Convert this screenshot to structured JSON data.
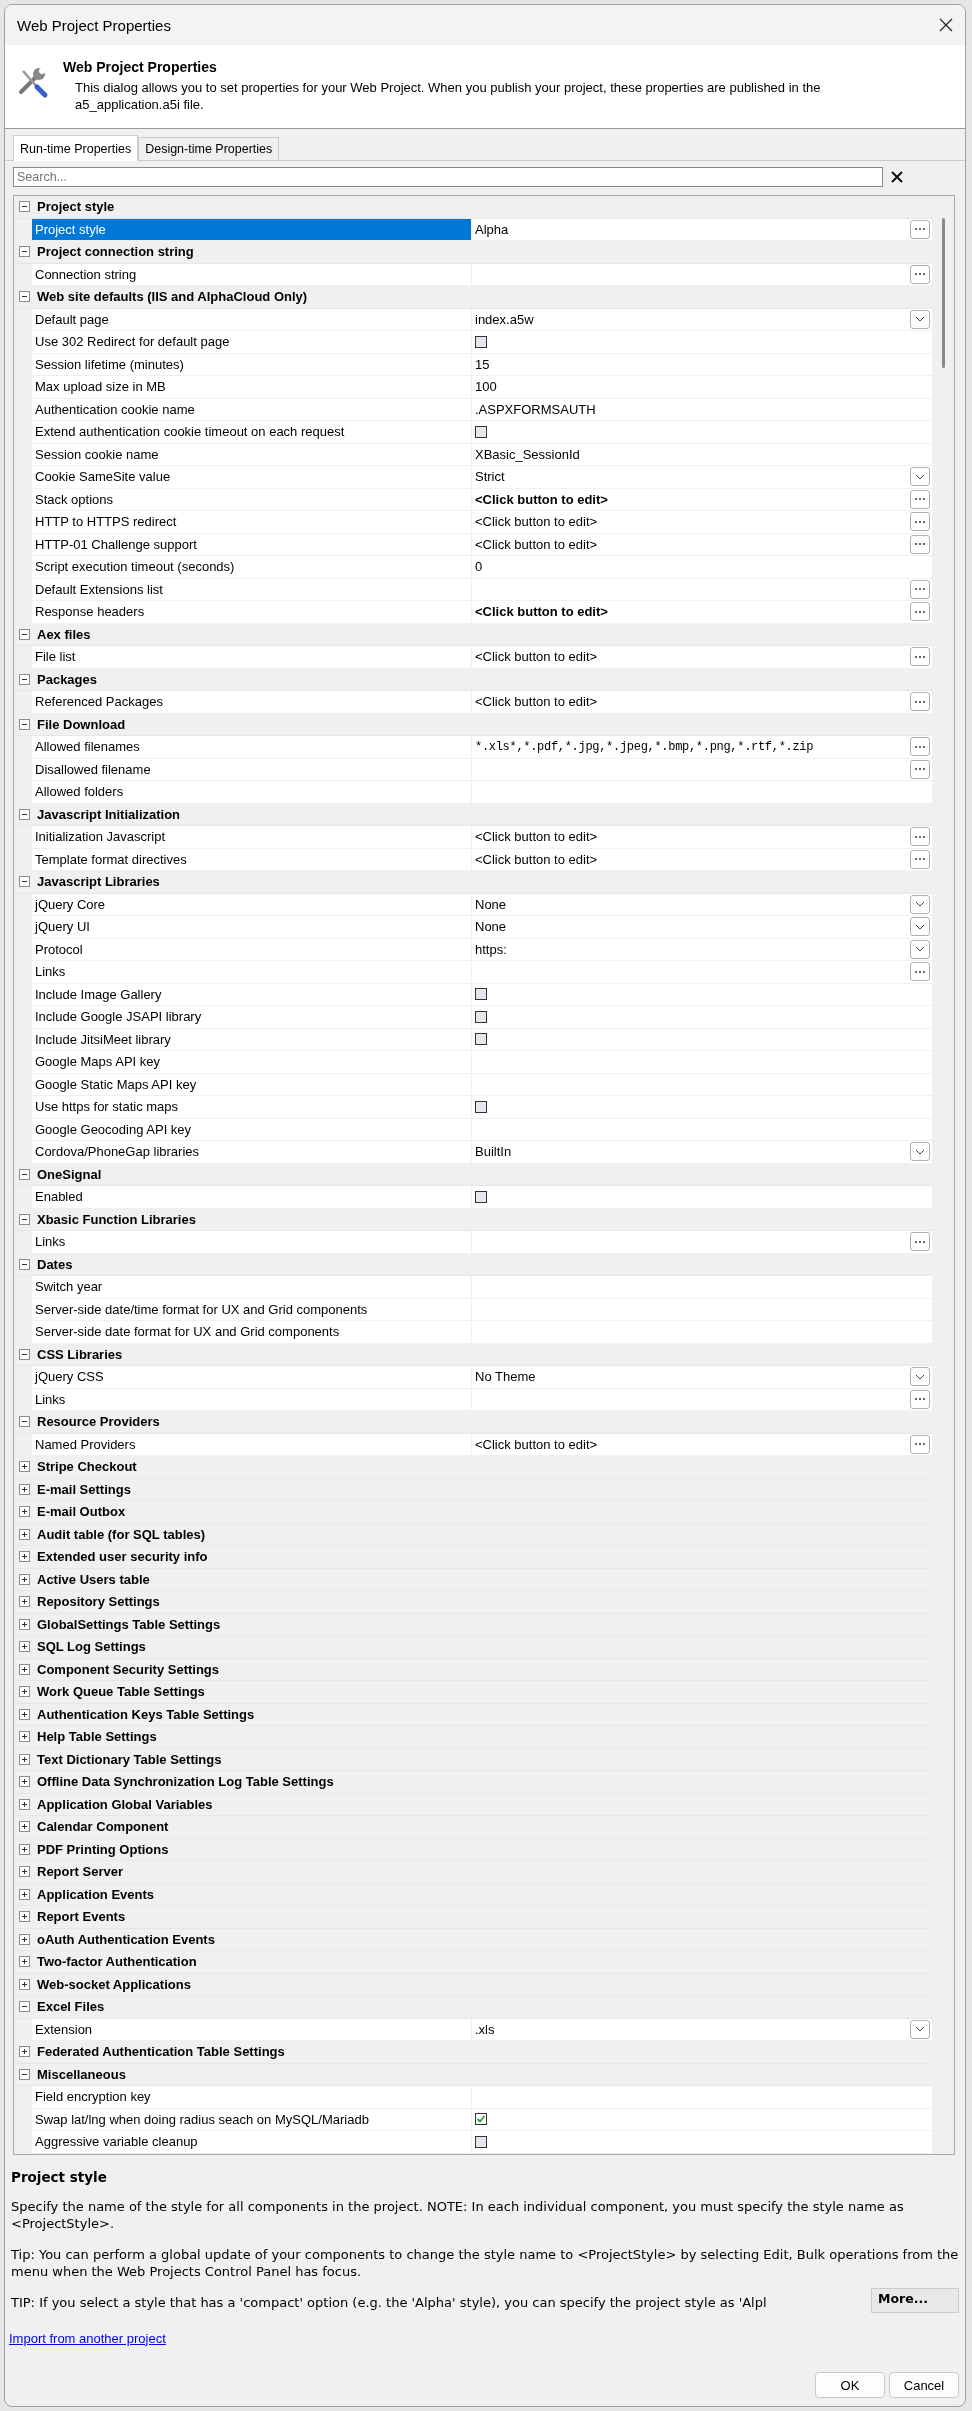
{
  "window": {
    "title": "Web Project Properties"
  },
  "header": {
    "title": "Web Project Properties",
    "description": "This dialog allows you to set properties for your Web Project. When you publish your project, these properties are published in the a5_application.a5i file."
  },
  "tabs": [
    {
      "label": "Run-time Properties",
      "selected": true
    },
    {
      "label": "Design-time Properties",
      "selected": false
    }
  ],
  "search": {
    "placeholder": "Search..."
  },
  "categories": [
    {
      "name": "Project style",
      "expanded": true,
      "properties": [
        {
          "name": "Project style",
          "kind": "text",
          "value": "Alpha",
          "button": {
            "kind": "ellipsis"
          },
          "selected": true
        }
      ]
    },
    {
      "name": "Project connection string",
      "expanded": true,
      "properties": [
        {
          "name": "Connection string",
          "kind": "text",
          "button": {
            "kind": "ellipsis"
          },
          "selected": false
        }
      ]
    },
    {
      "name": "Web site defaults (IIS and AlphaCloud Only)",
      "expanded": true,
      "properties": [
        {
          "name": "Default page",
          "kind": "text",
          "value": "index.a5w",
          "button": {
            "kind": "dropdown"
          },
          "selected": false
        },
        {
          "name": "Use 302 Redirect for default page",
          "kind": "checkbox",
          "checked": false,
          "selected": false
        },
        {
          "name": "Session lifetime (minutes)",
          "kind": "text",
          "value": "15",
          "selected": false
        },
        {
          "name": "Max upload size in MB",
          "kind": "text",
          "value": "100",
          "selected": false
        },
        {
          "name": "Authentication cookie name",
          "kind": "text",
          "value": ".ASPXFORMSAUTH",
          "selected": false
        },
        {
          "name": "Extend authentication cookie timeout on each request",
          "kind": "checkbox",
          "checked": false,
          "selected": false
        },
        {
          "name": "Session cookie name",
          "kind": "text",
          "value": "XBasic_SessionId",
          "selected": false
        },
        {
          "name": "Cookie SameSite value",
          "kind": "text",
          "value": "Strict",
          "button": {
            "kind": "dropdown"
          },
          "selected": false
        },
        {
          "name": "Stack options",
          "kind": "text",
          "value": "<Click button to edit>",
          "bold": true,
          "button": {
            "kind": "ellipsis"
          },
          "selected": false
        },
        {
          "name": "HTTP to HTTPS redirect",
          "kind": "text",
          "value": "<Click button to edit>",
          "button": {
            "kind": "ellipsis"
          },
          "selected": false
        },
        {
          "name": "HTTP-01 Challenge support",
          "kind": "text",
          "value": "<Click button to edit>",
          "button": {
            "kind": "ellipsis"
          },
          "selected": false
        },
        {
          "name": "Script execution timeout (seconds)",
          "kind": "text",
          "value": "0",
          "selected": false
        },
        {
          "name": "Default Extensions list",
          "kind": "text",
          "button": {
            "kind": "ellipsis"
          },
          "selected": false
        },
        {
          "name": "Response headers",
          "kind": "text",
          "value": "<Click button to edit>",
          "bold": true,
          "button": {
            "kind": "ellipsis"
          },
          "selected": false
        }
      ]
    },
    {
      "name": "Aex files",
      "expanded": true,
      "properties": [
        {
          "name": "File list",
          "kind": "text",
          "value": "<Click button to edit>",
          "button": {
            "kind": "ellipsis"
          },
          "selected": false
        }
      ]
    },
    {
      "name": "Packages",
      "expanded": true,
      "properties": [
        {
          "name": "Referenced Packages",
          "kind": "text",
          "value": "<Click button to edit>",
          "button": {
            "kind": "ellipsis"
          },
          "selected": false
        }
      ]
    },
    {
      "name": "File Download",
      "expanded": true,
      "properties": [
        {
          "name": "Allowed filenames",
          "kind": "text",
          "value": "*.xls*,*.pdf,*.jpg,*.jpeg,*.bmp,*.png,*.rtf,*.zip",
          "mono": true,
          "button": {
            "kind": "ellipsis"
          },
          "selected": false
        },
        {
          "name": "Disallowed filename",
          "kind": "text",
          "button": {
            "kind": "ellipsis"
          },
          "selected": false
        },
        {
          "name": "Allowed folders",
          "kind": "text",
          "selected": false
        }
      ]
    },
    {
      "name": "Javascript Initialization",
      "expanded": true,
      "properties": [
        {
          "name": "Initialization Javascript",
          "kind": "text",
          "value": "<Click button to edit>",
          "button": {
            "kind": "ellipsis"
          },
          "selected": false
        },
        {
          "name": "Template format directives",
          "kind": "text",
          "value": "<Click button to edit>",
          "button": {
            "kind": "ellipsis"
          },
          "selected": false
        }
      ]
    },
    {
      "name": "Javascript Libraries",
      "expanded": true,
      "properties": [
        {
          "name": "jQuery Core",
          "kind": "text",
          "value": "None",
          "button": {
            "kind": "dropdown"
          },
          "selected": false
        },
        {
          "name": "jQuery UI",
          "kind": "text",
          "value": "None",
          "button": {
            "kind": "dropdown"
          },
          "selected": false
        },
        {
          "name": "Protocol",
          "kind": "text",
          "value": "https:",
          "button": {
            "kind": "dropdown"
          },
          "selected": false
        },
        {
          "name": "Links",
          "kind": "text",
          "button": {
            "kind": "ellipsis"
          },
          "selected": false
        },
        {
          "name": "Include Image Gallery",
          "kind": "checkbox",
          "checked": false,
          "selected": false
        },
        {
          "name": "Include Google JSAPI library",
          "kind": "checkbox",
          "checked": false,
          "selected": false
        },
        {
          "name": "Include JitsiMeet library",
          "kind": "checkbox",
          "checked": false,
          "selected": false
        },
        {
          "name": "Google Maps API key",
          "kind": "text",
          "selected": false
        },
        {
          "name": "Google Static Maps API key",
          "kind": "text",
          "selected": false
        },
        {
          "name": "Use https for static maps",
          "kind": "checkbox",
          "checked": false,
          "selected": false
        },
        {
          "name": "Google Geocoding API key",
          "kind": "text",
          "selected": false
        },
        {
          "name": "Cordova/PhoneGap libraries",
          "kind": "text",
          "value": "BuiltIn",
          "button": {
            "kind": "dropdown"
          },
          "selected": false
        }
      ]
    },
    {
      "name": "OneSignal",
      "expanded": true,
      "properties": [
        {
          "name": "Enabled",
          "kind": "checkbox",
          "checked": false,
          "selected": false
        }
      ]
    },
    {
      "name": "Xbasic Function Libraries",
      "expanded": true,
      "properties": [
        {
          "name": "Links",
          "kind": "text",
          "button": {
            "kind": "ellipsis"
          },
          "selected": false
        }
      ]
    },
    {
      "name": "Dates",
      "expanded": true,
      "properties": [
        {
          "name": "Switch year",
          "kind": "text",
          "selected": false
        },
        {
          "name": "Server-side date/time format for UX and Grid components",
          "kind": "text",
          "selected": false
        },
        {
          "name": "Server-side date format for UX and Grid components",
          "kind": "text",
          "selected": false
        }
      ]
    },
    {
      "name": "CSS Libraries",
      "expanded": true,
      "properties": [
        {
          "name": "jQuery CSS",
          "kind": "text",
          "value": "No Theme",
          "button": {
            "kind": "dropdown"
          },
          "selected": false
        },
        {
          "name": "Links",
          "kind": "text",
          "button": {
            "kind": "ellipsis"
          },
          "selected": false
        }
      ]
    },
    {
      "name": "Resource Providers",
      "expanded": true,
      "properties": [
        {
          "name": "Named Providers",
          "kind": "text",
          "value": "<Click button to edit>",
          "button": {
            "kind": "ellipsis"
          },
          "selected": false
        }
      ]
    },
    {
      "name": "Stripe Checkout",
      "expanded": false
    },
    {
      "name": "E-mail Settings",
      "expanded": false
    },
    {
      "name": "E-mail Outbox",
      "expanded": false
    },
    {
      "name": "Audit table (for SQL tables)",
      "expanded": false
    },
    {
      "name": "Extended user security info",
      "expanded": false
    },
    {
      "name": "Active Users table",
      "expanded": false
    },
    {
      "name": "Repository Settings",
      "expanded": false
    },
    {
      "name": "GlobalSettings Table Settings",
      "expanded": false
    },
    {
      "name": "SQL Log Settings",
      "expanded": false
    },
    {
      "name": "Component Security Settings",
      "expanded": false
    },
    {
      "name": "Work Queue Table Settings",
      "expanded": false
    },
    {
      "name": "Authentication Keys Table Settings",
      "expanded": false
    },
    {
      "name": "Help Table Settings",
      "expanded": false
    },
    {
      "name": "Text Dictionary Table Settings",
      "expanded": false
    },
    {
      "name": "Offline Data Synchronization Log Table Settings",
      "expanded": false
    },
    {
      "name": "Application Global Variables",
      "expanded": false
    },
    {
      "name": "Calendar Component",
      "expanded": false
    },
    {
      "name": "PDF Printing Options",
      "expanded": false
    },
    {
      "name": "Report Server",
      "expanded": false
    },
    {
      "name": "Application Events",
      "expanded": false
    },
    {
      "name": "Report Events",
      "expanded": false
    },
    {
      "name": "oAuth Authentication Events",
      "expanded": false
    },
    {
      "name": "Two-factor Authentication",
      "expanded": false
    },
    {
      "name": "Web-socket Applications",
      "expanded": false
    },
    {
      "name": "Excel Files",
      "expanded": true,
      "properties": [
        {
          "name": "Extension",
          "kind": "text",
          "value": ".xls",
          "button": {
            "kind": "dropdown"
          },
          "selected": false
        }
      ]
    },
    {
      "name": "Federated Authentication Table Settings",
      "expanded": false
    },
    {
      "name": "Miscellaneous",
      "expanded": true,
      "properties": [
        {
          "name": "Field encryption key",
          "kind": "text",
          "selected": false
        },
        {
          "name": "Swap lat/lng when doing radius seach on MySQL/Mariadb",
          "kind": "checkbox",
          "checked": true,
          "selected": false
        },
        {
          "name": "Aggressive variable cleanup",
          "kind": "checkbox",
          "checked": false,
          "selected": false
        }
      ]
    }
  ],
  "description": {
    "title": "Project style",
    "paragraphs": [
      "Specify the name of the style for all components in the project. NOTE: In each individual component, you must specify the style name as <ProjectStyle>.",
      "Tip: You can perform a global update of your components to change the style name to <ProjectStyle> by selecting Edit, Bulk operations from the menu when the Web Projects Control Panel has focus.",
      "TIP: If you select a style that has a 'compact' option (e.g. the 'Alpha' style), you can specify the project style as 'Alpl"
    ]
  },
  "more_button": "More...",
  "link": "Import from another project",
  "buttons": [
    {
      "label": "OK"
    },
    {
      "label": "Cancel"
    }
  ]
}
